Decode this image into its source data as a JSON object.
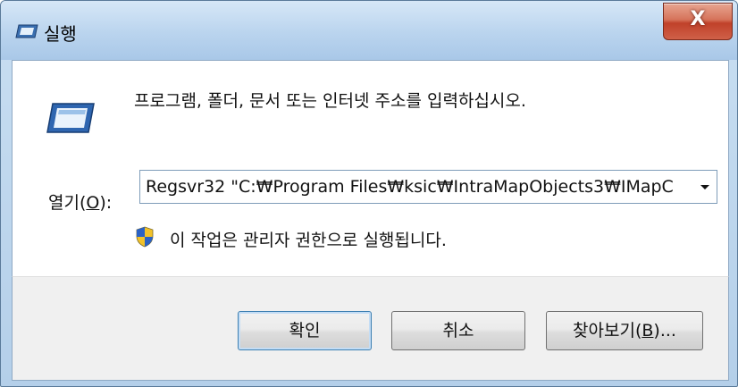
{
  "window": {
    "title": "실행",
    "close_label": "X"
  },
  "dialog": {
    "prompt": "프로그램, 폴더, 문서 또는 인터넷 주소를 입력하십시오.",
    "open_label": "열기(",
    "open_mnemonic": "O",
    "open_label_suffix": "):",
    "open_value": "Regsvr32 \"C:₩Program Files₩ksic₩IntraMapObjects3₩IMapC",
    "admin_note": "이 작업은 관리자 권한으로 실행됩니다."
  },
  "buttons": {
    "ok": "확인",
    "cancel": "취소",
    "browse_prefix": "찾아보기(",
    "browse_mnemonic": "B",
    "browse_suffix": ")..."
  },
  "icons": {
    "title": "run-icon",
    "main": "run-icon",
    "shield": "uac-shield-icon",
    "dropdown": "chevron-down-icon"
  }
}
